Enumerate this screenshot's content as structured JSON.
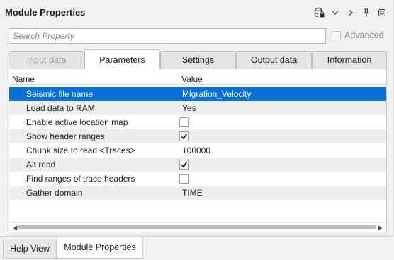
{
  "panel": {
    "title": "Module Properties"
  },
  "toolbar_icons": [
    "database-lock-icon",
    "chevron-down-icon",
    "chevron-right-icon",
    "pin-icon",
    "float-icon"
  ],
  "search": {
    "placeholder": "Search Property",
    "advanced_label": "Advanced"
  },
  "tabs": [
    {
      "label": "Input data",
      "state": "disabled"
    },
    {
      "label": "Parameters",
      "state": "active"
    },
    {
      "label": "Settings",
      "state": "normal"
    },
    {
      "label": "Output data",
      "state": "normal"
    },
    {
      "label": "Information",
      "state": "normal"
    }
  ],
  "grid": {
    "columns": [
      "Name",
      "Value"
    ],
    "rows": [
      {
        "name": "Seismic file name",
        "value": "Migration_Velocity",
        "type": "text",
        "selected": true
      },
      {
        "name": "Load data to RAM",
        "value": "Yes",
        "type": "text"
      },
      {
        "name": "Enable active location map",
        "value": "",
        "type": "checkbox",
        "checked": false
      },
      {
        "name": "Show header ranges",
        "value": "",
        "type": "checkbox",
        "checked": true
      },
      {
        "name": "Chunk size to read <Traces>",
        "value": "100000",
        "type": "text"
      },
      {
        "name": "Alt read",
        "value": "",
        "type": "checkbox",
        "checked": true
      },
      {
        "name": "Find ranges of trace headers",
        "value": "",
        "type": "checkbox",
        "checked": false
      },
      {
        "name": "Gather domain",
        "value": "TIME",
        "type": "text"
      }
    ]
  },
  "bottom_tabs": [
    {
      "label": "Help View",
      "state": "normal"
    },
    {
      "label": "Module Properties",
      "state": "active"
    }
  ],
  "colors": {
    "selection": "#0b6fd3",
    "alt_row": "#eeeeee"
  }
}
